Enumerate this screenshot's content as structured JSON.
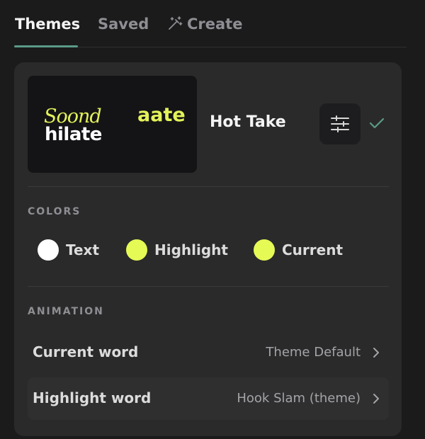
{
  "tabs": [
    {
      "label": "Themes",
      "active": true
    },
    {
      "label": "Saved",
      "active": false
    },
    {
      "label": "Create",
      "active": false,
      "icon": "magic-wand-icon"
    }
  ],
  "theme": {
    "preview": {
      "line1": "Soond",
      "line2": "hilate",
      "accent_word": "aate"
    },
    "name": "Hot Take",
    "selected": true
  },
  "colors": {
    "heading": "COLORS",
    "items": [
      {
        "label": "Text",
        "color": "#ffffff"
      },
      {
        "label": "Highlight",
        "color": "#e6fa55"
      },
      {
        "label": "Current",
        "color": "#e6fa55"
      }
    ]
  },
  "animation": {
    "heading": "ANIMATION",
    "rows": [
      {
        "label": "Current word",
        "value": "Theme Default"
      },
      {
        "label": "Highlight word",
        "value": "Hook Slam (theme)"
      }
    ]
  },
  "accent_color": "#5b9a86"
}
